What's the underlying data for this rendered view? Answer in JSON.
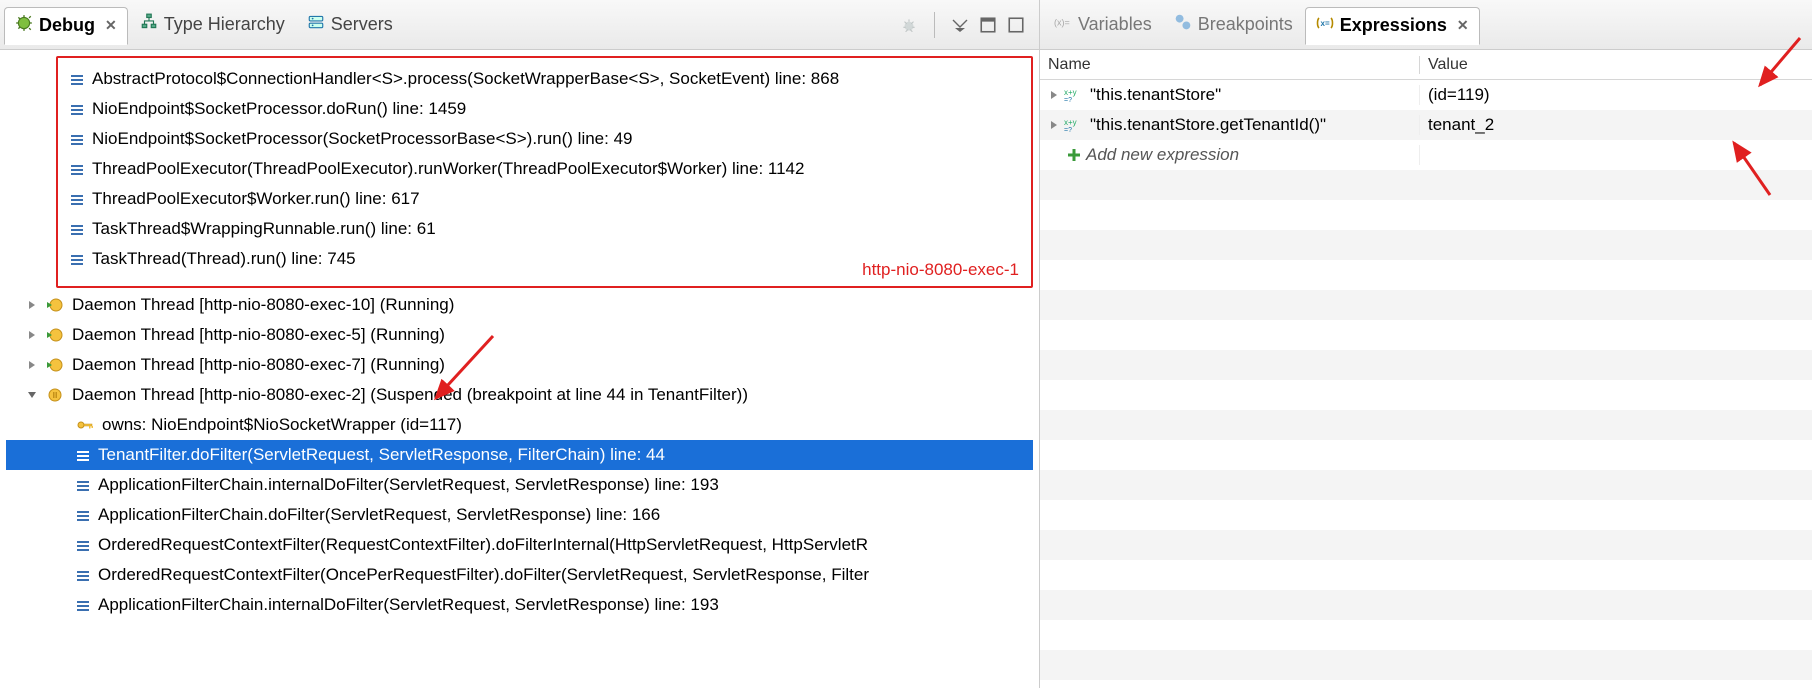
{
  "left": {
    "tabs": [
      {
        "label": "Debug",
        "active": true,
        "closable": true,
        "iconName": "debug-icon"
      },
      {
        "label": "Type Hierarchy",
        "active": false,
        "iconName": "type-hierarchy-icon"
      },
      {
        "label": "Servers",
        "active": false,
        "iconName": "servers-icon"
      }
    ],
    "boxedFrames": [
      "AbstractProtocol$ConnectionHandler<S>.process(SocketWrapperBase<S>, SocketEvent) line: 868",
      "NioEndpoint$SocketProcessor.doRun() line: 1459",
      "NioEndpoint$SocketProcessor(SocketProcessorBase<S>).run() line: 49",
      "ThreadPoolExecutor(ThreadPoolExecutor).runWorker(ThreadPoolExecutor$Worker) line: 1142",
      "ThreadPoolExecutor$Worker.run() line: 617",
      "TaskThread$WrappingRunnable.run() line: 61",
      "TaskThread(Thread).run() line: 745"
    ],
    "boxAnnotation": "http-nio-8080-exec-1",
    "threads": [
      {
        "label": "Daemon Thread [http-nio-8080-exec-10] (Running)",
        "expanded": false,
        "iconName": "running-thread-icon"
      },
      {
        "label": "Daemon Thread [http-nio-8080-exec-5] (Running)",
        "expanded": false,
        "iconName": "running-thread-icon"
      },
      {
        "label": "Daemon Thread [http-nio-8080-exec-7] (Running)",
        "expanded": false,
        "iconName": "running-thread-icon"
      }
    ],
    "suspendedThread": {
      "label": "Daemon Thread [http-nio-8080-exec-2] (Suspended (breakpoint at line 44 in TenantFilter))",
      "iconName": "suspended-thread-icon"
    },
    "owns": {
      "label": "owns: NioEndpoint$NioSocketWrapper  (id=117)",
      "iconName": "key-icon"
    },
    "selectedFrame": "TenantFilter.doFilter(ServletRequest, ServletResponse, FilterChain) line: 44",
    "framesBelow": [
      "ApplicationFilterChain.internalDoFilter(ServletRequest, ServletResponse) line: 193",
      "ApplicationFilterChain.doFilter(ServletRequest, ServletResponse) line: 166",
      "OrderedRequestContextFilter(RequestContextFilter).doFilterInternal(HttpServletRequest, HttpServletR",
      "OrderedRequestContextFilter(OncePerRequestFilter).doFilter(ServletRequest, ServletResponse, Filter",
      "ApplicationFilterChain.internalDoFilter(ServletRequest, ServletResponse) line: 193"
    ]
  },
  "right": {
    "tabs": [
      {
        "label": "Variables",
        "active": false,
        "closable": false,
        "iconName": "variables-icon"
      },
      {
        "label": "Breakpoints",
        "active": false,
        "closable": false,
        "iconName": "breakpoints-icon"
      },
      {
        "label": "Expressions",
        "active": true,
        "closable": true,
        "iconName": "expressions-icon"
      }
    ],
    "columns": {
      "name": "Name",
      "value": "Value"
    },
    "expressions": [
      {
        "name": "\"this.tenantStore\"",
        "value": "(id=119)"
      },
      {
        "name": "\"this.tenantStore.getTenantId()\"",
        "value": "tenant_2"
      }
    ],
    "addNew": "Add new expression"
  }
}
